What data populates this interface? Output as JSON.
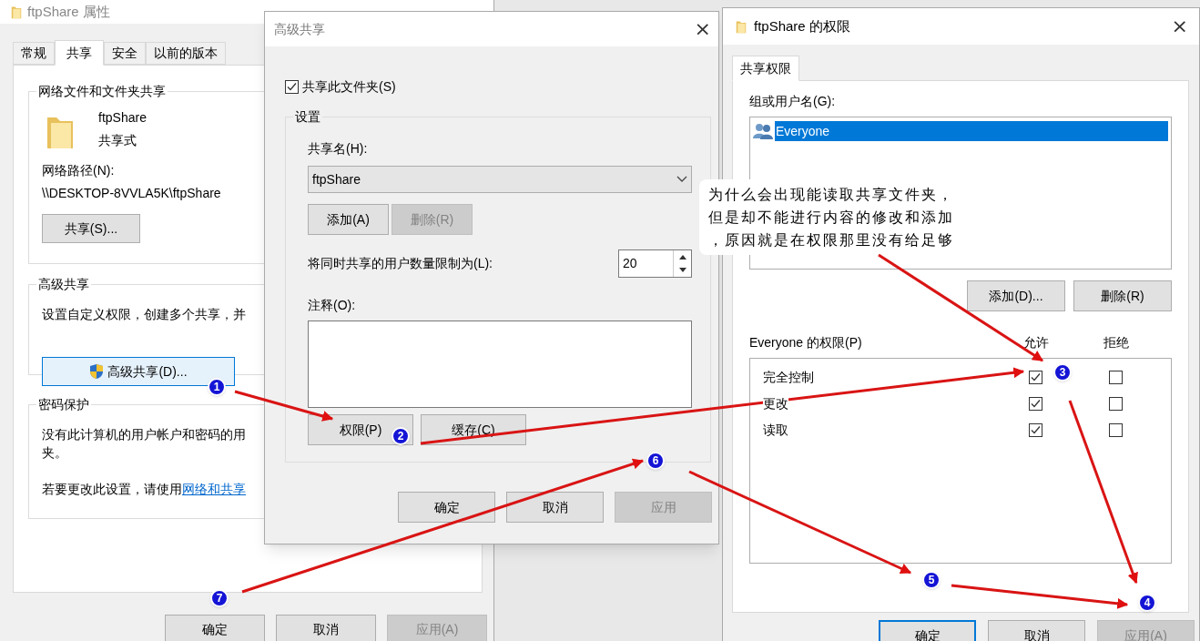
{
  "properties_dialog": {
    "title": "ftpShare 属性",
    "tabs": [
      {
        "label": "常规",
        "selected": false
      },
      {
        "label": "共享",
        "selected": true
      },
      {
        "label": "安全",
        "selected": false
      },
      {
        "label": "以前的版本",
        "selected": false
      }
    ],
    "network_sharing": {
      "title": "网络文件和文件夹共享",
      "name": "ftpShare",
      "status": "共享式",
      "path_label": "网络路径(N):",
      "path": "\\\\DESKTOP-8VVLA5K\\ftpShare",
      "button": "共享(S)..."
    },
    "advanced_sharing": {
      "title": "高级共享",
      "description": "设置自定义权限，创建多个共享，并",
      "button": "高级共享(D)..."
    },
    "password_protection": {
      "title": "密码保护",
      "lines": [
        "没有此计算机的用户帐户和密码的用",
        "夹。"
      ],
      "hint": "若要更改此设置，请使用",
      "link": "网络和共享"
    },
    "buttons": [
      {
        "label": "确定",
        "disabled": false
      },
      {
        "label": "取消",
        "disabled": false
      },
      {
        "label": "应用(A)",
        "disabled": true
      }
    ]
  },
  "advanced_dialog": {
    "title": "高级共享",
    "close": "×",
    "share_checkbox": {
      "label": "共享此文件夹(S)",
      "checked": true
    },
    "settings": {
      "title": "设置",
      "share_name_label": "共享名(H):",
      "share_name": "ftpShare",
      "name_buttons": [
        {
          "label": "添加(A)",
          "disabled": false
        },
        {
          "label": "删除(R)",
          "disabled": true
        }
      ],
      "limit_label": "将同时共享的用户数量限制为(L):",
      "limit": "20",
      "comment_label": "注释(O):",
      "buttons": [
        {
          "label": "权限(P)",
          "disabled": false
        },
        {
          "label": "缓存(C)",
          "disabled": false
        }
      ]
    },
    "buttons": [
      {
        "label": "确定",
        "disabled": false
      },
      {
        "label": "取消",
        "disabled": false
      },
      {
        "label": "应用",
        "disabled": true
      }
    ]
  },
  "permissions_dialog": {
    "title": "ftpShare 的权限",
    "close": "×",
    "tabs": [
      {
        "label": "共享权限",
        "selected": true
      }
    ],
    "group_label": "组或用户名(G):",
    "users": [
      {
        "name": "Everyone",
        "selected": true
      }
    ],
    "user_buttons": [
      {
        "label": "添加(D)...",
        "disabled": false
      },
      {
        "label": "删除(R)",
        "disabled": false
      }
    ],
    "permissions_label": "Everyone 的权限(P)",
    "columns": [
      "允许",
      "拒绝"
    ],
    "permissions": [
      {
        "name": "完全控制",
        "allow": true,
        "deny": false
      },
      {
        "name": "更改",
        "allow": true,
        "deny": false
      },
      {
        "name": "读取",
        "allow": true,
        "deny": false
      }
    ],
    "buttons": [
      {
        "label": "确定",
        "disabled": false,
        "focused": true
      },
      {
        "label": "取消",
        "disabled": false,
        "focused": false
      },
      {
        "label": "应用(A)",
        "disabled": true,
        "focused": false
      }
    ]
  },
  "callout": {
    "lines": [
      "为什么会出现能读取共享文件夹，",
      "但是却不能进行内容的修改和添加",
      "，原因就是在权限那里没有给足够"
    ]
  },
  "markers": [
    "1",
    "2",
    "3",
    "4",
    "5",
    "6",
    "7"
  ]
}
